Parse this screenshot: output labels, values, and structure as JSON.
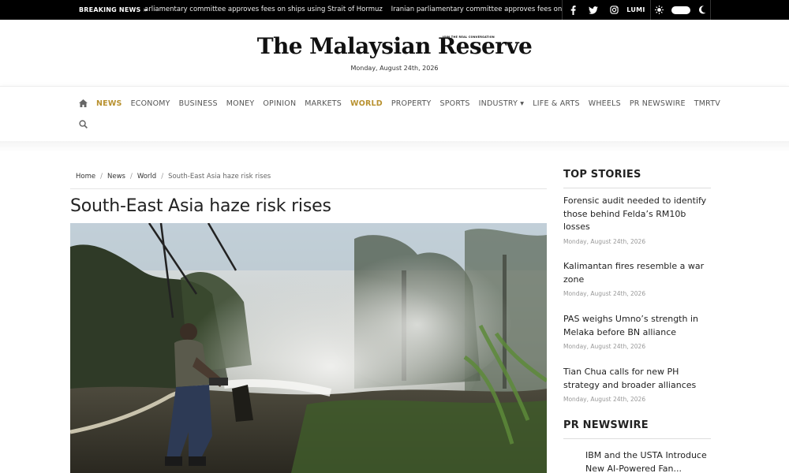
{
  "topbar": {
    "breaking_label": "BREAKING NEWS »",
    "ticker_items": [
      "arliamentary committee approves fees on ships using Strait of Hormuz",
      "Iranian parliamentary committee approves fees on shi"
    ],
    "social": [
      {
        "icon": "facebook-icon",
        "label": "f"
      },
      {
        "icon": "twitter-icon",
        "label": "🐦"
      },
      {
        "icon": "instagram-icon",
        "label": "◎"
      }
    ],
    "lumi_label": "LUMI"
  },
  "masthead": {
    "logo_text": "The Malaysian Reserve",
    "tagline": "JOIN THE REAL CONVERSATION",
    "date": "Monday, August 24th, 2026"
  },
  "nav": {
    "items": [
      {
        "label": "NEWS",
        "active": true
      },
      {
        "label": "ECONOMY",
        "active": false
      },
      {
        "label": "BUSINESS",
        "active": false
      },
      {
        "label": "MONEY",
        "active": false
      },
      {
        "label": "OPINION",
        "active": false
      },
      {
        "label": "MARKETS",
        "active": false
      },
      {
        "label": "WORLD",
        "active": true
      },
      {
        "label": "PROPERTY",
        "active": false
      },
      {
        "label": "SPORTS",
        "active": false
      },
      {
        "label": "INDUSTRY ▾",
        "active": false
      },
      {
        "label": "LIFE & ARTS",
        "active": false
      },
      {
        "label": "WHEELS",
        "active": false
      },
      {
        "label": "PR NEWSWIRE",
        "active": false
      },
      {
        "label": "TMRTV",
        "active": false
      }
    ]
  },
  "breadcrumb": {
    "home": "Home",
    "news": "News",
    "world": "World",
    "current": "South-East Asia haze risk rises",
    "separator": "/"
  },
  "article": {
    "title": "South-East Asia haze risk rises"
  },
  "sidebar": {
    "top_stories_heading": "TOP STORIES",
    "stories": [
      {
        "title": "Forensic audit needed to identify those behind Felda’s RM10b losses",
        "date": "Monday, August 24th, 2026"
      },
      {
        "title": "Kalimantan fires resemble a war zone",
        "date": "Monday, August 24th, 2026"
      },
      {
        "title": "PAS weighs Umno’s strength in Melaka before BN alliance",
        "date": "Monday, August 24th, 2026"
      },
      {
        "title": "Tian Chua calls for new PH strategy and broader alliances",
        "date": "Monday, August 24th, 2026"
      }
    ],
    "pr_heading": "PR NEWSWIRE",
    "pr_item": "IBM and the USTA Introduce New AI-Powered Fan..."
  },
  "colors": {
    "accent": "#b8912f",
    "topbar_bg": "#000000",
    "text": "#222222"
  }
}
